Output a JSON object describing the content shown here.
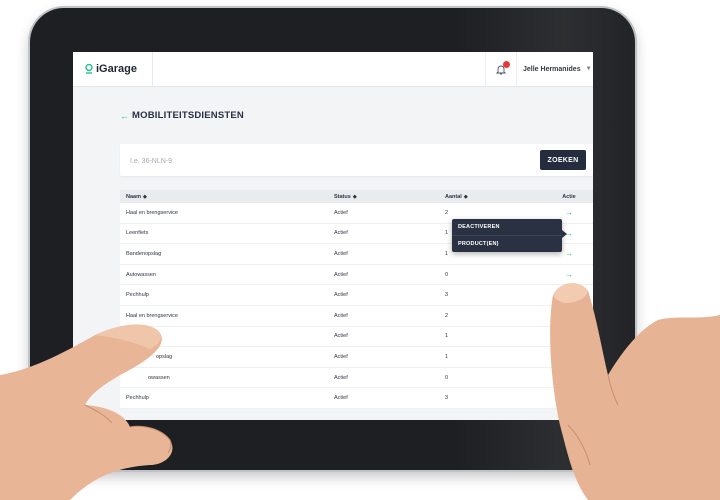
{
  "header": {
    "brand": "iGarage",
    "user_name": "Jelle Hermanides"
  },
  "page": {
    "title": "MOBILITEITSDIENSTEN",
    "search_placeholder": "I.e. 36-NLN-9",
    "search_button": "ZOEKEN"
  },
  "table": {
    "columns": [
      "Naam",
      "Status",
      "Aantal",
      "Actie"
    ],
    "rows": [
      {
        "naam": "Haal en brengservice",
        "status": "Actief",
        "aantal": "2"
      },
      {
        "naam": "Leenfiets",
        "status": "Actief",
        "aantal": "1"
      },
      {
        "naam": "Bandenopslag",
        "status": "Actief",
        "aantal": "1"
      },
      {
        "naam": "Autowassen",
        "status": "Actief",
        "aantal": "0"
      },
      {
        "naam": "Pechhulp",
        "status": "Actief",
        "aantal": "3"
      },
      {
        "naam": "Haal en brengservice",
        "status": "Actief",
        "aantal": "2"
      },
      {
        "naam": "",
        "status": "Actief",
        "aantal": "1"
      },
      {
        "naam": "opslag",
        "status": "Actief",
        "aantal": "1"
      },
      {
        "naam": "owassen",
        "status": "Actief",
        "aantal": "0"
      },
      {
        "naam": "Pechhulp",
        "status": "Actief",
        "aantal": "3"
      }
    ]
  },
  "menu": {
    "items": [
      "DEACTIVEREN",
      "PRODUCT(EN)"
    ]
  },
  "colors": {
    "accent": "#28c08b",
    "dark": "#252c3d",
    "notification": "#e23a3a",
    "bezel": "#1e1f22"
  },
  "icons": {
    "back": "arrow-left-icon",
    "bell": "bell-icon",
    "action": "arrow-right-icon",
    "logo": "location-pin-icon"
  }
}
